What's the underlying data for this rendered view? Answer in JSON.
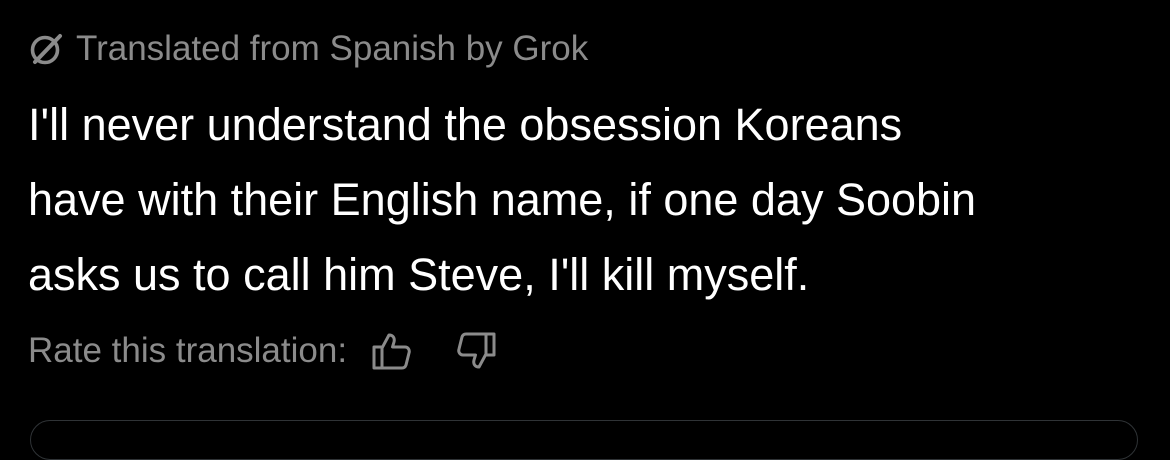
{
  "translation": {
    "attribution": "Translated from Spanish by Grok",
    "icon": "grok-icon",
    "text_lines": [
      "I'll never understand the obsession Koreans",
      "have with their English name, if one day Soobin",
      "asks us to call him Steve, I'll kill myself."
    ],
    "rate_label": "Rate this translation:",
    "rate_icons": [
      "thumbs-up-icon",
      "thumbs-down-icon"
    ]
  },
  "colors": {
    "background": "#000000",
    "text_primary": "#ffffff",
    "text_secondary": "#8b8b8b",
    "border": "#2f3336"
  }
}
